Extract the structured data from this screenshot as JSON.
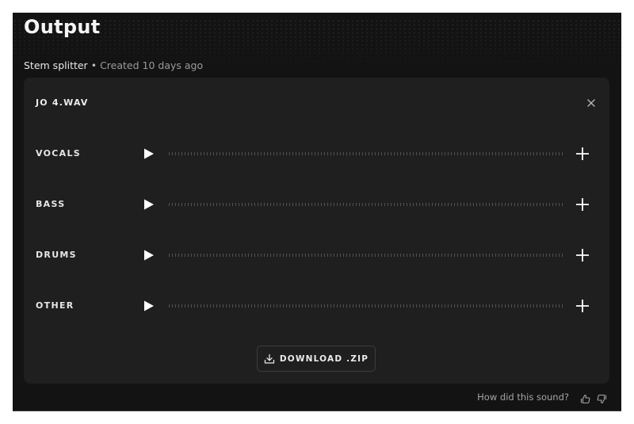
{
  "page": {
    "title": "Output",
    "subtitle": {
      "tool": "Stem splitter",
      "separator": "•",
      "created": "Created 10 days ago"
    }
  },
  "card": {
    "filename": "JO 4.WAV",
    "close_icon": "close-icon",
    "stems": [
      {
        "label": "VOCALS",
        "play_icon": "play-icon",
        "add_icon": "plus-icon"
      },
      {
        "label": "BASS",
        "play_icon": "play-icon",
        "add_icon": "plus-icon"
      },
      {
        "label": "DRUMS",
        "play_icon": "play-icon",
        "add_icon": "plus-icon"
      },
      {
        "label": "OTHER",
        "play_icon": "play-icon",
        "add_icon": "plus-icon"
      }
    ],
    "download": {
      "label": "DOWNLOAD .ZIP",
      "icon": "download-icon"
    }
  },
  "feedback": {
    "question": "How did this sound?",
    "thumbs_up_icon": "thumbs-up-icon",
    "thumbs_down_icon": "thumbs-down-icon"
  },
  "colors": {
    "container_bg": "#131313",
    "card_bg": "#1f1f1f",
    "text_primary": "#eaeaea",
    "text_muted": "#9a9a9a"
  }
}
